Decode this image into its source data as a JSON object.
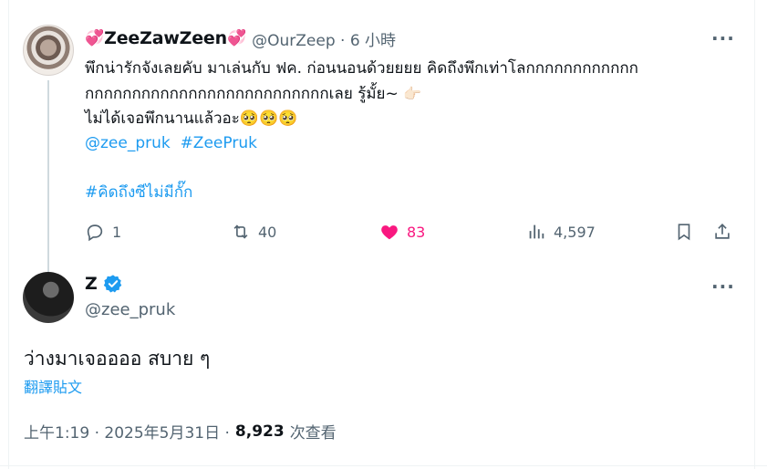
{
  "parent_tweet": {
    "display_name": "ZeeZawZeen",
    "name_emoji_left": "💞",
    "name_emoji_right": "💞",
    "handle_time": "@OurZeep · 6 小時",
    "lines": [
      "พึกน่ารักจังเลยคับ มาเล่นกับ ฟค. ก่อนนอนด้วยยยย คิดถึงพึกเท่าโลกกกกกกกกกกกก",
      "กกกกกกกกกกกกกกกกกกกกกกกกกกเลย รู้มั้ย~",
      "ไม่ได้เจอพึกนานแล้วอะ🥺🥺🥺"
    ],
    "line2_emoji": "👉🏻",
    "mention": "@zee_pruk",
    "hashtag1": "#ZeePruk",
    "hashtag2": "#คิดถึงซีไม่มีกั๊ก",
    "replies": "1",
    "reposts": "40",
    "likes": "83",
    "views": "4,597"
  },
  "reply_tweet": {
    "display_name": "Z",
    "handle": "@zee_pruk",
    "text": "ว่างมาเจออออ สบาย ๆ",
    "translate_label": "翻譯貼文",
    "timestamp": "上午1:19 · 2025年5月31日 ·",
    "views_count": "8,923",
    "views_label": "次查看"
  },
  "colors": {
    "accent": "#1d9bf0",
    "like": "#f91880",
    "secondary_text": "#536471"
  },
  "icons": [
    "more-icon",
    "reply-icon",
    "repost-icon",
    "like-icon",
    "views-icon",
    "bookmark-icon",
    "share-icon",
    "verified-icon"
  ]
}
